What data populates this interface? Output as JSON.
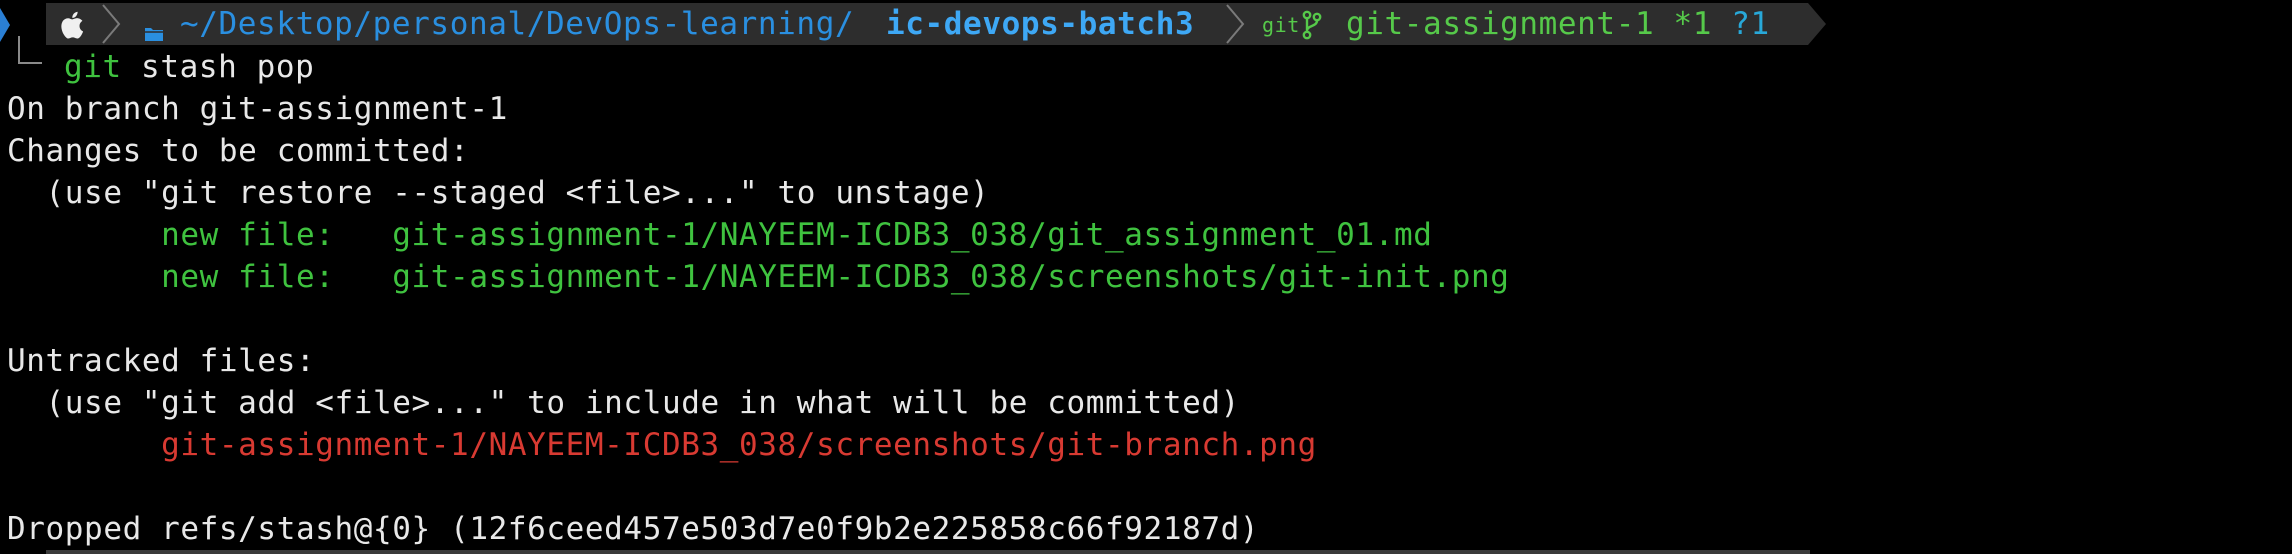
{
  "prompt": {
    "path_prefix": "~/Desktop/personal/DevOps-learning/",
    "path_current": "ic-devops-batch3",
    "vcs_label": "git",
    "branch_status": "git-assignment-1 *1 ",
    "untracked_status": "?1"
  },
  "command": {
    "name": "git",
    "args": " stash pop"
  },
  "output": {
    "branch_line": "On branch git-assignment-1",
    "staged_header": "Changes to be committed:",
    "staged_hint": "  (use \"git restore --staged <file>...\" to unstage)",
    "staged_files": [
      "        new file:   git-assignment-1/NAYEEM-ICDB3_038/git_assignment_01.md",
      "        new file:   git-assignment-1/NAYEEM-ICDB3_038/screenshots/git-init.png"
    ],
    "untracked_header": "Untracked files:",
    "untracked_hint": "  (use \"git add <file>...\" to include in what will be committed)",
    "untracked_files": [
      "        git-assignment-1/NAYEEM-ICDB3_038/screenshots/git-branch.png"
    ],
    "dropped_line": "Dropped refs/stash@{0} (12f6ceed457e503d7e0f9b2e225858c66f92187d)"
  },
  "colors": {
    "background": "#000000",
    "prompt_bar": "#2d2d2d",
    "staged": "#3fc23f",
    "untracked": "#d83a32",
    "path": "#2a8fe0"
  }
}
